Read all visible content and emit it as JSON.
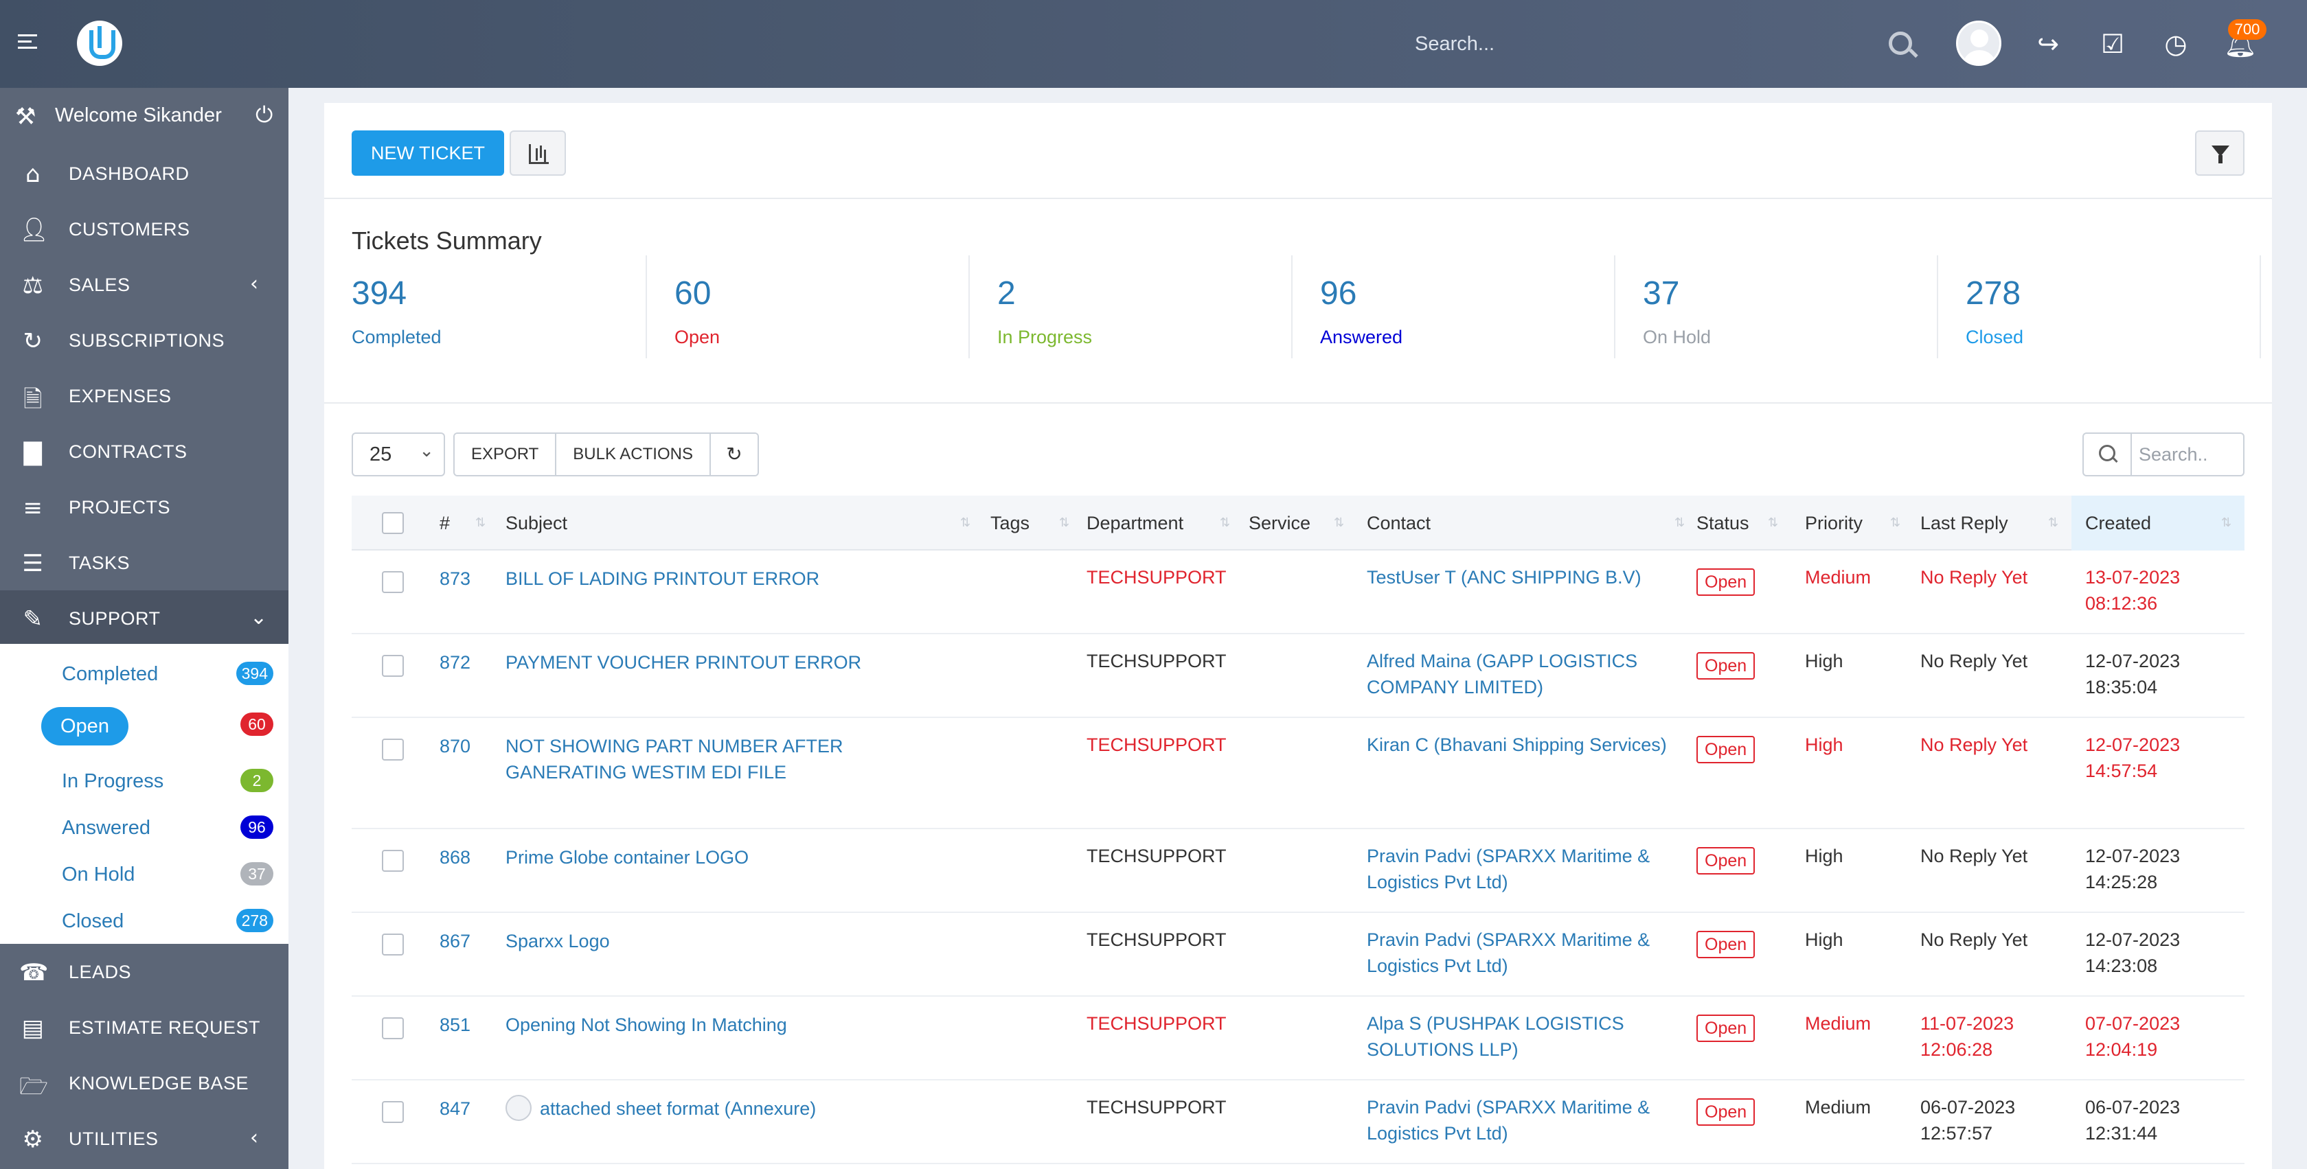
{
  "topbar": {
    "search_placeholder": "Search...",
    "notifications_count": "700",
    "colors": {
      "bar": "#4a5870",
      "badge": "#ff6f00"
    }
  },
  "sidebar": {
    "welcome": "Welcome Sikander",
    "items": [
      {
        "label": "DASHBOARD",
        "icon": "home-icon"
      },
      {
        "label": "CUSTOMERS",
        "icon": "user-icon"
      },
      {
        "label": "SALES",
        "icon": "balance-scale-icon",
        "chevron": "left"
      },
      {
        "label": "SUBSCRIPTIONS",
        "icon": "refresh-icon"
      },
      {
        "label": "EXPENSES",
        "icon": "document-icon"
      },
      {
        "label": "CONTRACTS",
        "icon": "file-icon"
      },
      {
        "label": "PROJECTS",
        "icon": "bars-icon"
      },
      {
        "label": "TASKS",
        "icon": "tasks-icon"
      },
      {
        "label": "SUPPORT",
        "icon": "ticket-icon",
        "chevron": "down"
      }
    ],
    "support_submenu": [
      {
        "label": "Completed",
        "count": "394",
        "color": "#1e9be8"
      },
      {
        "label": "Open",
        "count": "60",
        "color": "#e0242e"
      },
      {
        "label": "In Progress",
        "count": "2",
        "color": "#7cb82f"
      },
      {
        "label": "Answered",
        "count": "96",
        "color": "#0000d6"
      },
      {
        "label": "On Hold",
        "count": "37",
        "color": "#b0b4ba"
      },
      {
        "label": "Closed",
        "count": "278",
        "color": "#1e9be8"
      }
    ],
    "items_after": [
      {
        "label": "LEADS",
        "icon": "tty-icon"
      },
      {
        "label": "ESTIMATE REQUEST",
        "icon": "list-alt-icon"
      },
      {
        "label": "KNOWLEDGE BASE",
        "icon": "folder-open-icon"
      },
      {
        "label": "UTILITIES",
        "icon": "cogs-icon",
        "chevron": "left"
      }
    ]
  },
  "toolbar": {
    "new_ticket_label": "NEW TICKET"
  },
  "summary": {
    "title": "Tickets Summary",
    "stats": [
      {
        "value": "394",
        "label": "Completed",
        "color": "#2a7bb6"
      },
      {
        "value": "60",
        "label": "Open",
        "color": "#e0242e"
      },
      {
        "value": "2",
        "label": "In Progress",
        "color": "#7cb82f"
      },
      {
        "value": "96",
        "label": "Answered",
        "color": "#0000d6"
      },
      {
        "value": "37",
        "label": "On Hold",
        "color": "#9aa0a8"
      },
      {
        "value": "278",
        "label": "Closed",
        "color": "#1e9be8"
      }
    ]
  },
  "table_controls": {
    "page_length": "25",
    "export_label": "EXPORT",
    "bulk_actions_label": "BULK ACTIONS",
    "search_placeholder": "Search.."
  },
  "table": {
    "columns": [
      "#",
      "Subject",
      "Tags",
      "Department",
      "Service",
      "Contact",
      "Status",
      "Priority",
      "Last Reply",
      "Created"
    ],
    "rows": [
      {
        "id": "873",
        "subject": "BILL OF LADING PRINTOUT ERROR",
        "subject2": "",
        "department": "TECHSUPPORT",
        "contact": "TestUser T (ANC SHIPPING B.V)",
        "contact2": "",
        "status": "Open",
        "priority": "Medium",
        "last_reply": "No Reply Yet",
        "last_reply2": "",
        "created": "13-07-2023",
        "created2": "08:12:36",
        "highlight": true
      },
      {
        "id": "872",
        "subject": "PAYMENT VOUCHER PRINTOUT ERROR",
        "subject2": "",
        "department": "TECHSUPPORT",
        "contact": "Alfred Maina (GAPP LOGISTICS",
        "contact2": "COMPANY LIMITED)",
        "status": "Open",
        "priority": "High",
        "last_reply": "No Reply Yet",
        "last_reply2": "",
        "created": "12-07-2023",
        "created2": "18:35:04",
        "highlight": false
      },
      {
        "id": "870",
        "subject": "NOT SHOWING PART NUMBER AFTER",
        "subject2": "GANERATING WESTIM EDI FILE",
        "department": "TECHSUPPORT",
        "contact": "Kiran C (Bhavani Shipping Services)",
        "contact2": "",
        "status": "Open",
        "priority": "High",
        "last_reply": "No Reply Yet",
        "last_reply2": "",
        "created": "12-07-2023",
        "created2": "14:57:54",
        "highlight": true
      },
      {
        "id": "868",
        "subject": "Prime Globe container LOGO",
        "subject2": "",
        "department": "TECHSUPPORT",
        "contact": "Pravin Padvi (SPARXX Maritime &",
        "contact2": "Logistics Pvt Ltd)",
        "status": "Open",
        "priority": "High",
        "last_reply": "No Reply Yet",
        "last_reply2": "",
        "created": "12-07-2023",
        "created2": "14:25:28",
        "highlight": false
      },
      {
        "id": "867",
        "subject": "Sparxx Logo",
        "subject2": "",
        "department": "TECHSUPPORT",
        "contact": "Pravin Padvi (SPARXX Maritime &",
        "contact2": "Logistics Pvt Ltd)",
        "status": "Open",
        "priority": "High",
        "last_reply": "No Reply Yet",
        "last_reply2": "",
        "created": "12-07-2023",
        "created2": "14:23:08",
        "highlight": false
      },
      {
        "id": "851",
        "subject": "Opening Not Showing In Matching",
        "subject2": "",
        "department": "TECHSUPPORT",
        "contact": "Alpa S (PUSHPAK LOGISTICS",
        "contact2": "SOLUTIONS LLP)",
        "status": "Open",
        "priority": "Medium",
        "last_reply": "11-07-2023",
        "last_reply2": "12:06:28",
        "created": "07-07-2023",
        "created2": "12:04:19",
        "highlight": true
      },
      {
        "id": "847",
        "subject": "attached sheet format (Annexure)",
        "subject2": "",
        "department": "TECHSUPPORT",
        "contact": "Pravin Padvi (SPARXX Maritime &",
        "contact2": "Logistics Pvt Ltd)",
        "status": "Open",
        "priority": "Medium",
        "last_reply": "06-07-2023",
        "last_reply2": "12:57:57",
        "created": "06-07-2023",
        "created2": "12:31:44",
        "highlight": false,
        "has_avatar": true
      }
    ]
  }
}
